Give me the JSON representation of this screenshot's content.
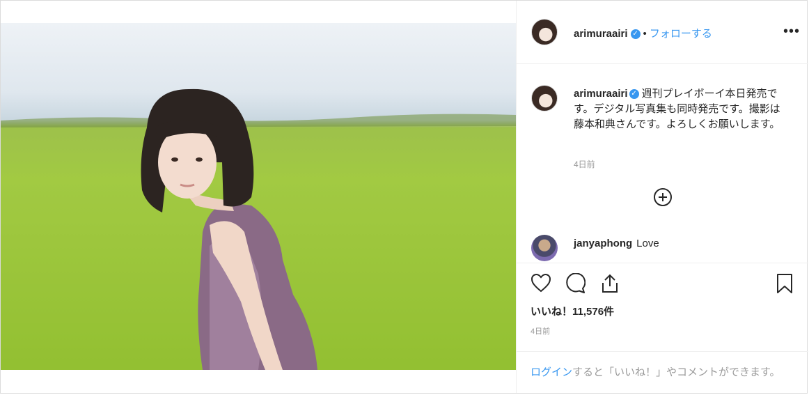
{
  "post": {
    "username": "arimuraairi",
    "verified_mark": "✓",
    "separator": "•",
    "follow_label": "フォローする",
    "more_label": "•••"
  },
  "caption": {
    "username": "arimuraairi",
    "text": "週刊プレイボーイ本日発売です。デジタル写真集も同時発売です。撮影は藤本和典さんです。よろしくお願いします。",
    "time": "4日前"
  },
  "comments": [
    {
      "username": "janyaphong",
      "text": "Love"
    }
  ],
  "actions": {
    "like_icon": "heart-icon",
    "comment_icon": "comment-icon",
    "share_icon": "share-icon",
    "save_icon": "bookmark-icon",
    "likes_text": "いいね！11,576件",
    "time": "4日前"
  },
  "login_prompt": {
    "login_label": "ログイン",
    "rest": "すると「いいね！」やコメントができます。"
  },
  "colors": {
    "link": "#3897f0",
    "text": "#262626",
    "muted": "#999999",
    "border": "#efefef"
  }
}
